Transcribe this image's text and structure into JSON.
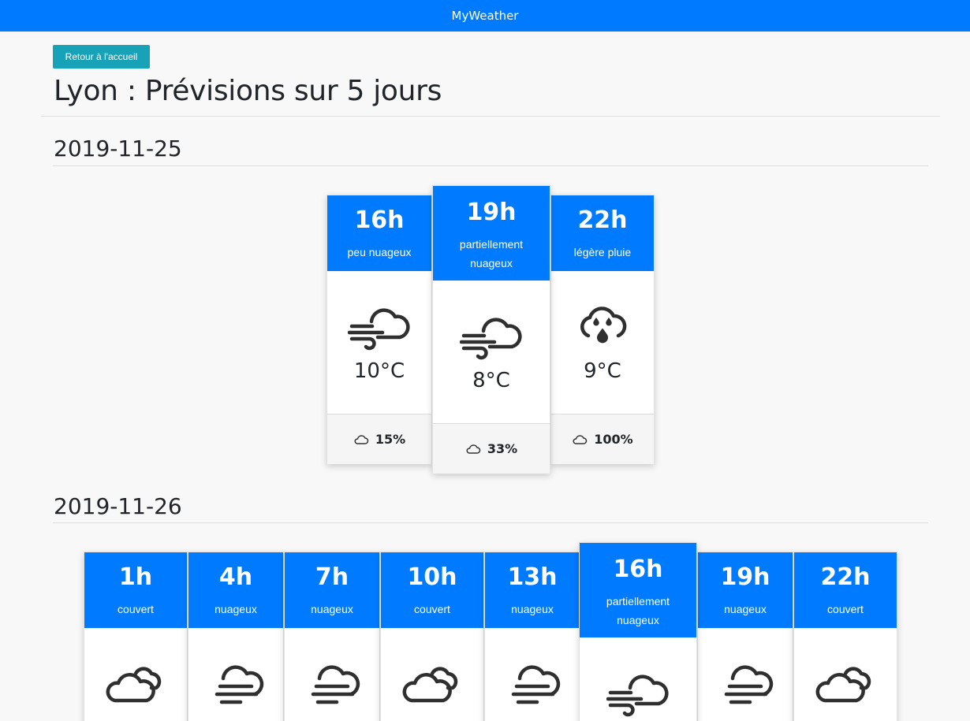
{
  "navbar": {
    "title": "MyWeather"
  },
  "back_button": "Retour à l'accueil",
  "page_title": "Lyon : Prévisions sur 5 jours",
  "days": [
    {
      "date": "2019-11-25",
      "forecasts": [
        {
          "hour": "16h",
          "desc": "peu nuageux",
          "temp": "10°C",
          "clouds": "15%",
          "icon": "wind-cloud-icon",
          "highlight": false
        },
        {
          "hour": "19h",
          "desc": "partiellement nuageux",
          "temp": "8°C",
          "clouds": "33%",
          "icon": "wind-cloud-icon",
          "highlight": true
        },
        {
          "hour": "22h",
          "desc": "légère pluie",
          "temp": "9°C",
          "clouds": "100%",
          "icon": "rain-cloud-icon",
          "highlight": false
        }
      ]
    },
    {
      "date": "2019-11-26",
      "forecasts": [
        {
          "hour": "1h",
          "desc": "couvert",
          "icon": "clouds-icon",
          "highlight": false
        },
        {
          "hour": "4h",
          "desc": "nuageux",
          "icon": "fog-cloud-icon",
          "highlight": false
        },
        {
          "hour": "7h",
          "desc": "nuageux",
          "icon": "fog-cloud-icon",
          "highlight": false
        },
        {
          "hour": "10h",
          "desc": "couvert",
          "icon": "clouds-icon",
          "highlight": false
        },
        {
          "hour": "13h",
          "desc": "nuageux",
          "icon": "fog-cloud-icon",
          "highlight": false
        },
        {
          "hour": "16h",
          "desc": "partiellement nuageux",
          "icon": "wind-cloud-icon",
          "highlight": true
        },
        {
          "hour": "19h",
          "desc": "nuageux",
          "icon": "fog-cloud-icon",
          "highlight": false
        },
        {
          "hour": "22h",
          "desc": "couvert",
          "icon": "clouds-icon",
          "highlight": false
        }
      ]
    }
  ],
  "colors": {
    "primary": "#007bff",
    "info": "#17a2b8"
  }
}
